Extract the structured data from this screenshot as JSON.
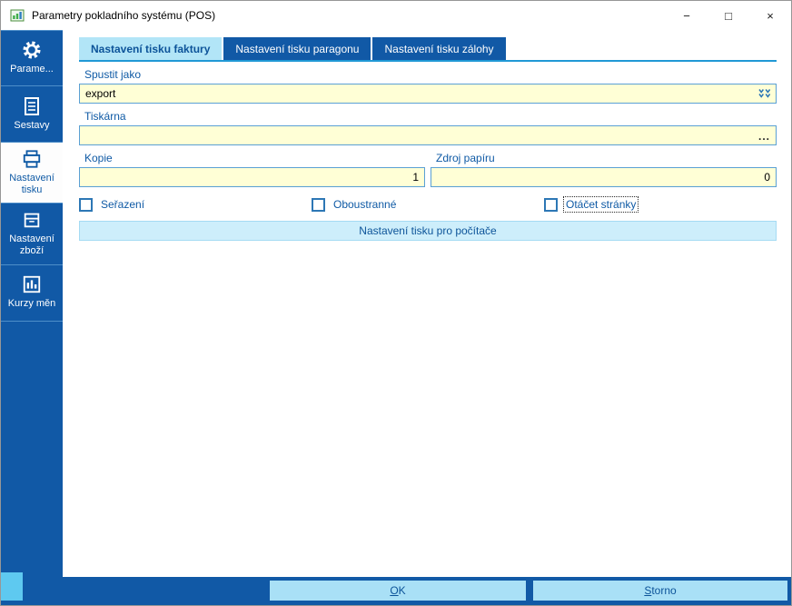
{
  "window": {
    "title": "Parametry pokladního systému (POS)",
    "controls": {
      "minimize": "−",
      "maximize": "□",
      "close": "×"
    }
  },
  "sidebar": {
    "items": [
      {
        "label": "Parame...",
        "icon": "gear-icon",
        "active": false
      },
      {
        "label": "Sestavy",
        "icon": "report-icon",
        "active": false
      },
      {
        "label": "Nastavení tisku",
        "icon": "printer-icon",
        "active": true
      },
      {
        "label": "Nastavení zboží",
        "icon": "goods-icon",
        "active": false
      },
      {
        "label": "Kurzy měn",
        "icon": "currency-chart-icon",
        "active": false
      }
    ]
  },
  "tabs": [
    {
      "label": "Nastavení tisku faktury",
      "active": true
    },
    {
      "label": "Nastavení tisku paragonu",
      "active": false
    },
    {
      "label": "Nastavení tisku zálohy",
      "active": false
    }
  ],
  "form": {
    "run_as": {
      "label": "Spustit jako",
      "value": "export"
    },
    "printer": {
      "label": "Tiskárna",
      "value": "",
      "browse_label": "..."
    },
    "copies": {
      "label": "Kopie",
      "value": "1"
    },
    "paper_source": {
      "label": "Zdroj papíru",
      "value": "0"
    },
    "checkboxes": [
      {
        "label": "Seřazení",
        "checked": false,
        "focused": false
      },
      {
        "label": "Oboustranné",
        "checked": false,
        "focused": false
      },
      {
        "label": "Otáčet stránky",
        "checked": false,
        "focused": true
      }
    ],
    "computer_print_button": "Nastavení tisku pro počítače"
  },
  "footer": {
    "ok": {
      "key": "O",
      "rest": "K"
    },
    "storno": {
      "key": "S",
      "rest": "torno"
    }
  },
  "colors": {
    "primary_blue": "#1159a6",
    "tab_active_bg": "#b2e5f7",
    "tab_underline": "#2098d5",
    "input_bg": "#ffffd6",
    "input_border": "#5aa0d4",
    "wide_button_bg": "#cdeefb",
    "footer_button_bg": "#a9e0f6",
    "corner_tile": "#5ec9f0"
  }
}
